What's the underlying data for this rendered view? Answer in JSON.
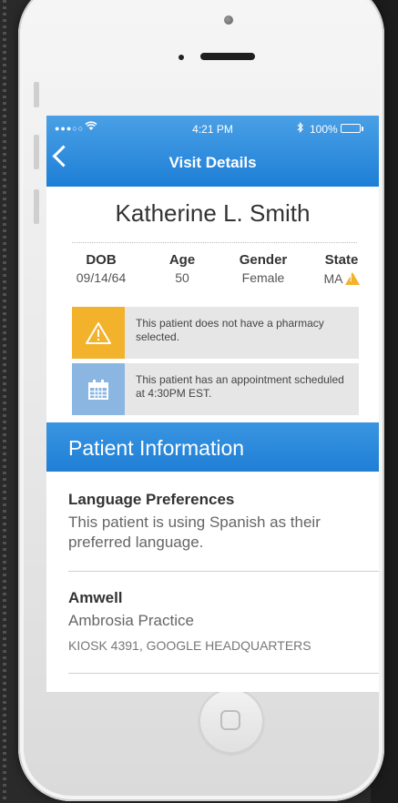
{
  "status_bar": {
    "signal": "●●●○○",
    "wifi_icon": "wifi-icon",
    "time": "4:21 PM",
    "bluetooth_icon": "bluetooth-icon",
    "battery_percent": "100%"
  },
  "nav": {
    "back_icon": "chevron-left-icon",
    "title": "Visit Details"
  },
  "patient": {
    "name": "Katherine L. Smith",
    "facts": [
      {
        "label": "DOB",
        "value": "09/14/64"
      },
      {
        "label": "Age",
        "value": "50"
      },
      {
        "label": "Gender",
        "value": "Female"
      },
      {
        "label": "State",
        "value": "MA"
      }
    ]
  },
  "alerts": [
    {
      "icon": "warning-icon",
      "color": "#f2b22b",
      "text": "This patient does not have a pharmacy selected."
    },
    {
      "icon": "calendar-icon",
      "color": "#8cb6e2",
      "text": "This patient has an appointment scheduled at 4:30PM EST."
    }
  ],
  "section": {
    "title": "Patient Information"
  },
  "language": {
    "heading": "Language Preferences",
    "body": "This patient is using Spanish as their preferred language."
  },
  "practice": {
    "heading": "Amwell",
    "name": "Ambrosia Practice",
    "address": "KIOSK 4391, GOOGLE HEADQUARTERS"
  },
  "colors": {
    "nav_blue": "#1e7fd6",
    "warning_yellow": "#f2b22b",
    "calendar_blue": "#8cb6e2"
  }
}
